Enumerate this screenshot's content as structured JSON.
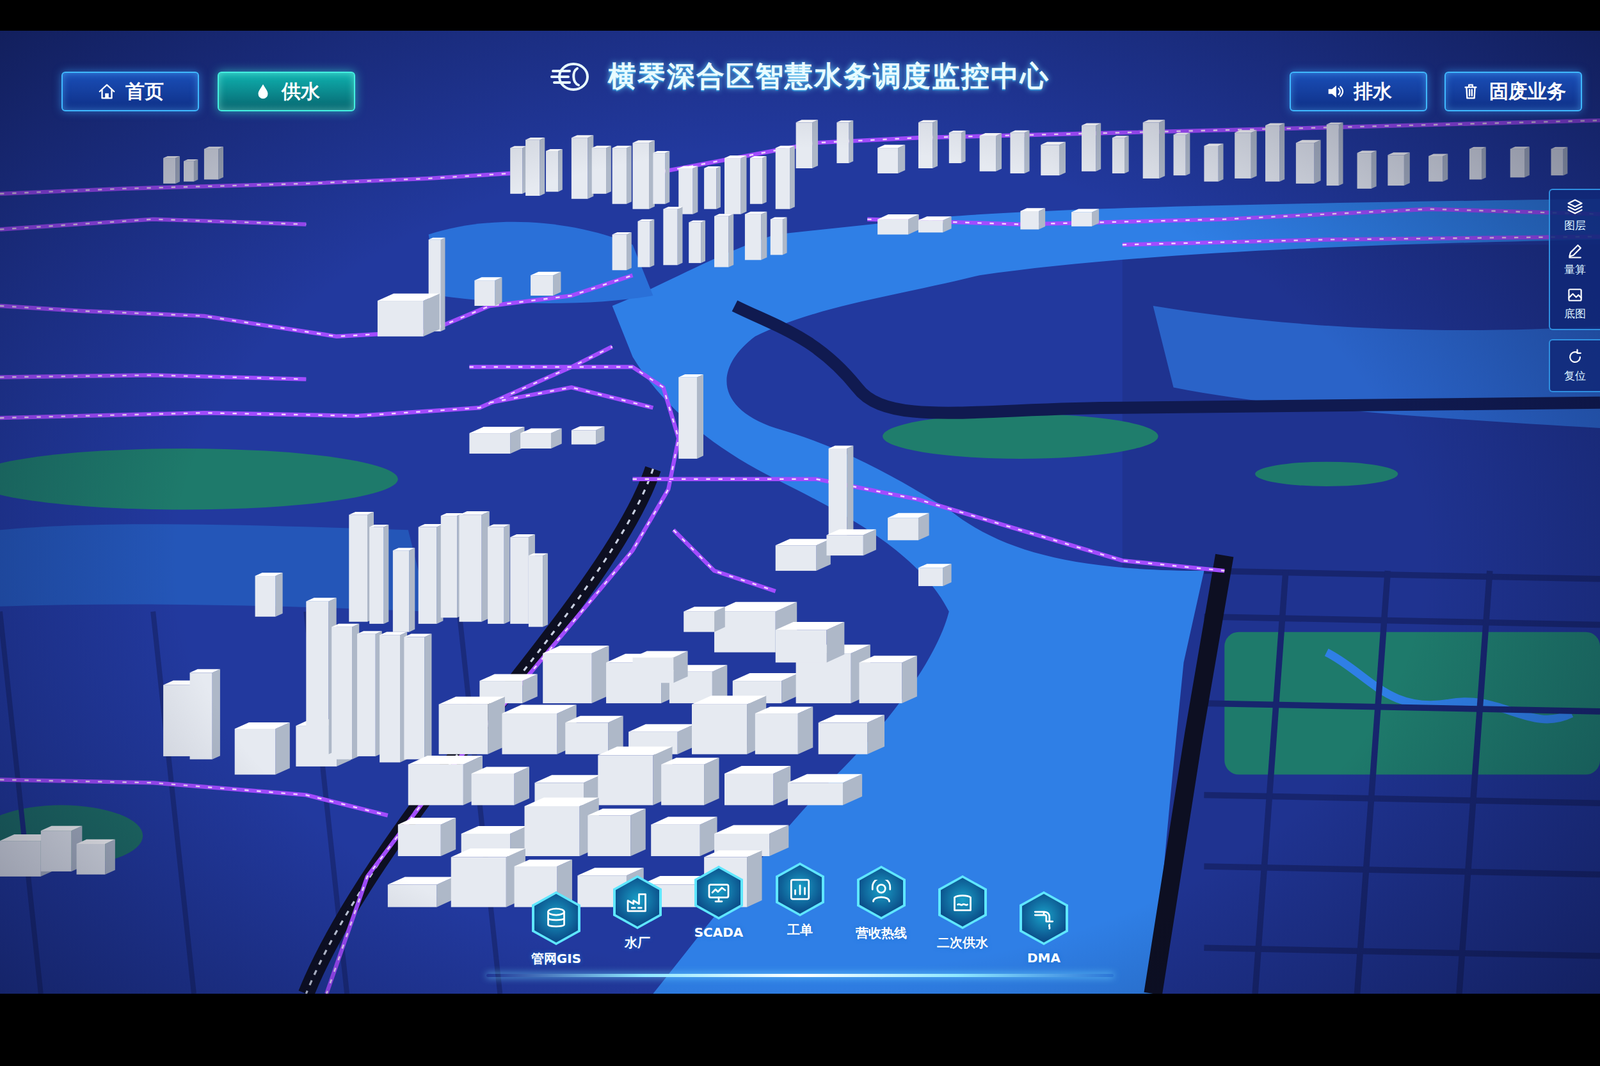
{
  "header": {
    "title": "横琴深合区智慧水务调度监控中心"
  },
  "nav_left": [
    {
      "label": "首页",
      "selected": false
    },
    {
      "label": "供水",
      "selected": true
    }
  ],
  "nav_right": [
    {
      "label": "排水",
      "selected": false
    },
    {
      "label": "固废业务",
      "selected": false
    }
  ],
  "toolbar": [
    {
      "label": "图层"
    },
    {
      "label": "量算"
    },
    {
      "label": "底图"
    },
    {
      "label": "复位"
    }
  ],
  "dock": [
    {
      "label": "管网GIS",
      "selected": false
    },
    {
      "label": "水厂",
      "selected": false
    },
    {
      "label": "SCADA",
      "selected": false
    },
    {
      "label": "工单",
      "selected": false
    },
    {
      "label": "营收热线",
      "selected": false
    },
    {
      "label": "二次供水",
      "selected": false
    },
    {
      "label": "DMA",
      "selected": false
    }
  ]
}
